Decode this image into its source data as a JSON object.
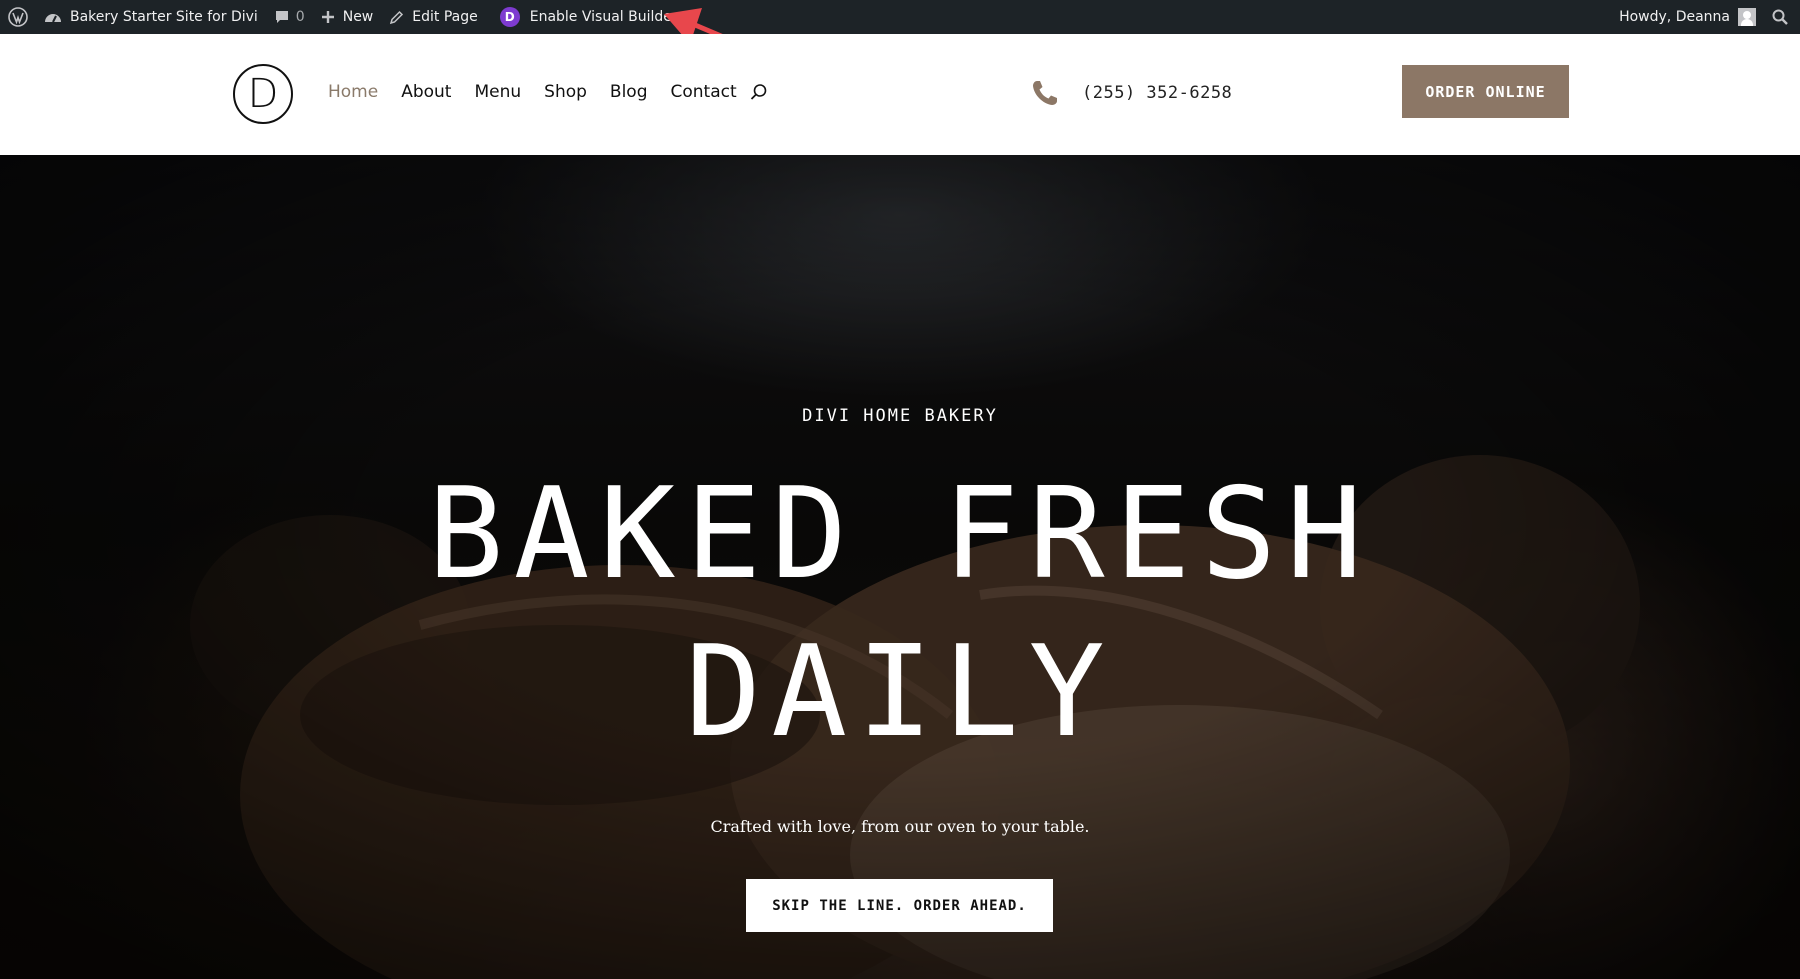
{
  "adminbar": {
    "site_name": "Bakery Starter Site for Divi",
    "comments_count": "0",
    "new_label": "New",
    "edit_label": "Edit Page",
    "divi_badge": "D",
    "visual_builder_label": "Enable Visual Builder",
    "howdy": "Howdy, Deanna"
  },
  "header": {
    "logo_letter": "D",
    "nav": {
      "home": "Home",
      "about": "About",
      "menu": "Menu",
      "shop": "Shop",
      "blog": "Blog",
      "contact": "Contact"
    },
    "phone": "(255) 352-6258",
    "order_button": "ORDER ONLINE"
  },
  "hero": {
    "eyebrow": "DIVI HOME BAKERY",
    "title_line1": "BAKED FRESH",
    "title_line2": "DAILY",
    "tagline": "Crafted with love, from our oven to your table.",
    "cta": "SKIP THE LINE. ORDER AHEAD."
  },
  "colors": {
    "admin_bar": "#1d2327",
    "accent_brown": "#8c7766",
    "nav_active": "#8a7a6a",
    "annotation_arrow": "#e8474c",
    "divi_purple": "#7e3bd0"
  }
}
